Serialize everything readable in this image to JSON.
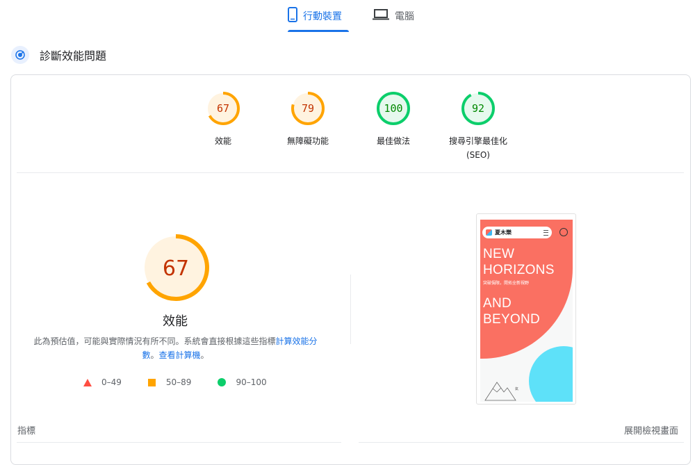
{
  "tabs": {
    "mobile": {
      "label": "行動裝置",
      "icon": "smartphone-icon",
      "selected": true
    },
    "desktop": {
      "label": "電腦",
      "icon": "laptop-icon",
      "selected": false
    }
  },
  "section": {
    "title": "診斷效能問題",
    "icon": "diagnostics-icon"
  },
  "scores": [
    {
      "value": "67",
      "label": "效能",
      "label2": "",
      "fraction": 0.67,
      "status": "average"
    },
    {
      "value": "79",
      "label": "無障礙功能",
      "label2": "",
      "fraction": 0.79,
      "status": "average"
    },
    {
      "value": "100",
      "label": "最佳做法",
      "label2": "",
      "fraction": 1.0,
      "status": "pass"
    },
    {
      "value": "92",
      "label": "搜尋引擎最佳化",
      "label2": "(SEO)",
      "fraction": 0.92,
      "status": "pass"
    }
  ],
  "performance": {
    "score": "67",
    "fraction": 0.67,
    "title": "效能",
    "description_text": "此為預估值，可能與實際情況有所不同。系統會直接根據這些指標",
    "link1": "計算效能分數",
    "separator": "。",
    "link2": "查看計算機",
    "end": "。"
  },
  "legend": [
    {
      "range": "0–49",
      "shape": "triangle",
      "color": "#ff4e42"
    },
    {
      "range": "50–89",
      "shape": "square",
      "color": "#ffa400"
    },
    {
      "range": "90–100",
      "shape": "circle",
      "color": "#0cce6b"
    }
  ],
  "screenshot": {
    "brand": "夏木樂",
    "headline1": "NEW",
    "headline2": "HORIZONS",
    "sub": "突破侷限，開拓全新視野",
    "headline3": "AND",
    "headline4": "BEYOND",
    "small": "氣"
  },
  "footer": {
    "metrics_label": "指標",
    "expand_label": "展開檢視畫面"
  },
  "colors": {
    "accent": "#1a73e8",
    "average": "#ffa400",
    "average_text": "#c33300",
    "average_bg": "#fff3e0",
    "pass": "#0cce6b",
    "pass_text": "#008800",
    "pass_bg": "#e6f9ee",
    "fail": "#ff4e42"
  }
}
